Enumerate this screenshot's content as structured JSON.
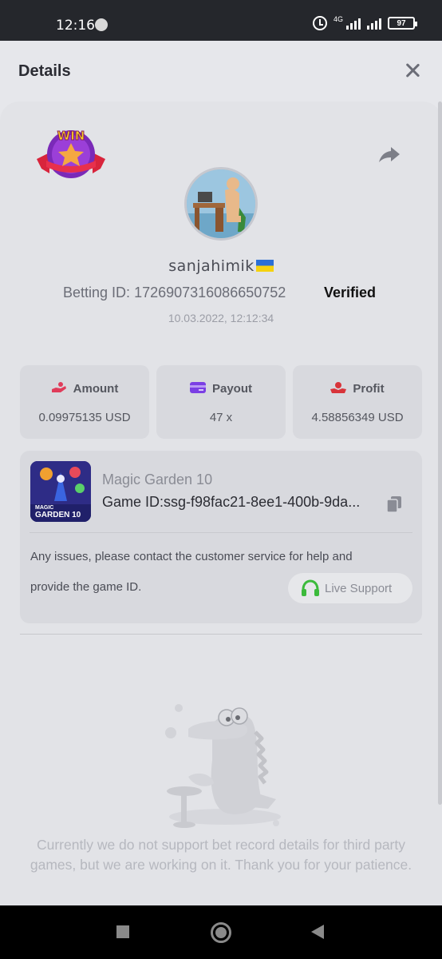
{
  "status_bar": {
    "time": "12:16",
    "network": "4G",
    "battery": "97"
  },
  "header": {
    "title": "Details"
  },
  "bet": {
    "username": "sanjahimik",
    "betting_id_label": "Betting ID:",
    "betting_id": "1726907316086650752",
    "verified": "Verified",
    "date": "10.03.2022, 12:12:34",
    "win_badge_text": "WIN"
  },
  "stats": [
    {
      "label": "Amount",
      "value": "0.09975135 USD",
      "icon": "money-hand-icon",
      "color": "#e03c5a"
    },
    {
      "label": "Payout",
      "value": "47 x",
      "icon": "card-icon",
      "color": "#7b3fe4"
    },
    {
      "label": "Profit",
      "value": "4.58856349 USD",
      "icon": "coin-hand-icon",
      "color": "#d8343a"
    }
  ],
  "game": {
    "name": "Magic Garden 10",
    "id_label": "Game ID:",
    "id_value": "ssg-f98fac21-8ee1-400b-9da...",
    "thumb_text_1": "MAGIC",
    "thumb_text_2": "GARDEN 10",
    "issue_line_1": "Any issues, please contact the customer service for help and",
    "issue_line_2": "provide the game ID.",
    "live_support": "Live Support"
  },
  "empty_state": {
    "message": "Currently we do not support bet record details for third party games, but we are working on it. Thank you for your patience."
  },
  "colors": {
    "accent_green": "#3cba3c",
    "background": "#e2e3e7"
  }
}
